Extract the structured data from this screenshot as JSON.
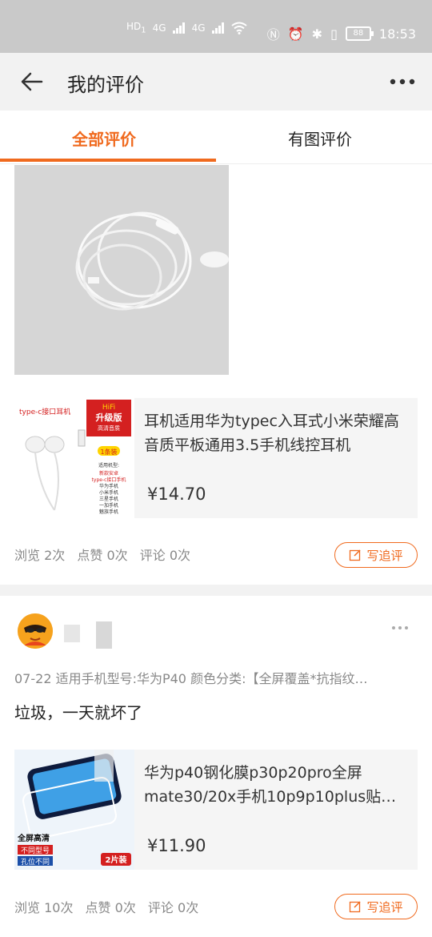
{
  "status_bar": {
    "time": "18:53",
    "battery": "88",
    "network_1": "4G",
    "network_2": "4G"
  },
  "nav": {
    "title": "我的评价"
  },
  "tabs": [
    {
      "label": "全部评价",
      "active": true
    },
    {
      "label": "有图评价",
      "active": false
    }
  ],
  "review1": {
    "product": {
      "name": "耳机适用华为typec入耳式小米荣耀高音质平板通用3.5手机线控耳机",
      "price": "¥14.70",
      "thumb_text": {
        "type_label": "type-c接口耳机",
        "hifi": "HiFi",
        "upgrade": "升级版",
        "hq": "高清音质",
        "one_pack": "1条装",
        "fit_title": "适用机型:",
        "fit_lines": [
          "新款安卓",
          "type-c接口手机",
          "华为手机",
          "小米手机",
          "三星手机",
          "一加手机",
          "魅族手机"
        ]
      }
    },
    "stats": {
      "views": "浏览 2次",
      "likes": "点赞 0次",
      "comments": "评论 0次"
    },
    "followup_label": "写追评"
  },
  "review2": {
    "meta": "07-22  适用手机型号:华为P40 颜色分类:【全屏覆盖*抗指纹…",
    "text": "垃圾，一天就坏了",
    "product": {
      "name": "华为p40钢化膜p30p20pro全屏mate30/20x手机10p9p10plus贴…",
      "price": "¥11.90",
      "thumb_text": {
        "fullscreen": "全屏高清",
        "diff_model": "不同型号",
        "hole_diff": "孔位不同",
        "pack": "2片装"
      }
    },
    "stats": {
      "views": "浏览 10次",
      "likes": "点赞 0次",
      "comments": "评论 0次"
    },
    "followup_label": "写追评"
  },
  "colors": {
    "accent": "#f06a1e",
    "nav_bg": "#f2f2f2",
    "card_bg": "#f5f5f5"
  }
}
